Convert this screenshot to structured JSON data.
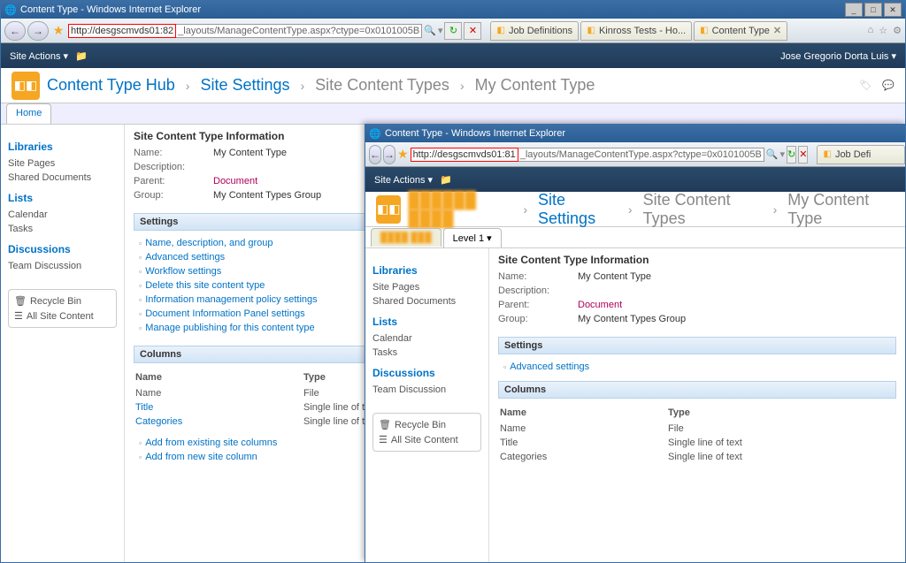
{
  "window1": {
    "title": "Content Type - Windows Internet Explorer",
    "address_highlight": "http://desgscmvds01:82",
    "address_tail": "_layouts/ManageContentType.aspx?ctype=0x0101005B",
    "tabs": [
      {
        "label": "Job Definitions"
      },
      {
        "label": "Kinross Tests - Ho..."
      },
      {
        "label": "Content Type",
        "closable": true
      }
    ],
    "user_name": "Jose Gregorio Dorta Luis",
    "site_actions": "Site Actions ▾",
    "breadcrumb": [
      "Content Type Hub",
      "Site Settings",
      "Site Content Types",
      "My Content Type"
    ],
    "home_tab": "Home",
    "leftnav": {
      "libraries": {
        "head": "Libraries",
        "items": [
          "Site Pages",
          "Shared Documents"
        ]
      },
      "lists": {
        "head": "Lists",
        "items": [
          "Calendar",
          "Tasks"
        ]
      },
      "discussions": {
        "head": "Discussions",
        "items": [
          "Team Discussion"
        ]
      },
      "recycle": "Recycle Bin",
      "allsite": "All Site Content"
    },
    "info": {
      "title": "Site Content Type Information",
      "name_lbl": "Name:",
      "name_val": "My Content Type",
      "desc_lbl": "Description:",
      "desc_val": "",
      "parent_lbl": "Parent:",
      "parent_val": "Document",
      "group_lbl": "Group:",
      "group_val": "My Content Types Group"
    },
    "settings_hdr": "Settings",
    "settings_links": [
      "Name, description, and group",
      "Advanced settings",
      "Workflow settings",
      "Delete this site content type",
      "Information management policy settings",
      "Document Information Panel settings",
      "Manage publishing for this content type"
    ],
    "columns_hdr": "Columns",
    "col_head_name": "Name",
    "col_head_type": "Type",
    "columns": [
      {
        "name": "Name",
        "type": "File",
        "link": false
      },
      {
        "name": "Title",
        "type": "Single line of text",
        "link": true
      },
      {
        "name": "Categories",
        "type": "Single line of text",
        "link": true
      }
    ],
    "col_actions": [
      "Add from existing site columns",
      "Add from new site column"
    ]
  },
  "window2": {
    "title": "Content Type - Windows Internet Explorer",
    "address_highlight": "http://desgscmvds01:81",
    "address_tail": "_layouts/ManageContentType.aspx?ctype=0x0101005B",
    "tab_trunc": "Job Defi",
    "site_actions": "Site Actions ▾",
    "breadcrumb_first_blur": "██████ ████",
    "breadcrumb": [
      "Site Settings",
      "Site Content Types",
      "My Content Type"
    ],
    "tabrow": {
      "first_blur": "████ ███",
      "level": "Level 1 ▾"
    },
    "leftnav": {
      "libraries": {
        "head": "Libraries",
        "items": [
          "Site Pages",
          "Shared Documents"
        ]
      },
      "lists": {
        "head": "Lists",
        "items": [
          "Calendar",
          "Tasks"
        ]
      },
      "discussions": {
        "head": "Discussions",
        "items": [
          "Team Discussion"
        ]
      },
      "recycle": "Recycle Bin",
      "allsite": "All Site Content"
    },
    "info": {
      "title": "Site Content Type Information",
      "name_lbl": "Name:",
      "name_val": "My Content Type",
      "desc_lbl": "Description:",
      "desc_val": "",
      "parent_lbl": "Parent:",
      "parent_val": "Document",
      "group_lbl": "Group:",
      "group_val": "My Content Types Group"
    },
    "settings_hdr": "Settings",
    "settings_links": [
      "Advanced settings"
    ],
    "columns_hdr": "Columns",
    "col_head_name": "Name",
    "col_head_type": "Type",
    "columns": [
      {
        "name": "Name",
        "type": "File"
      },
      {
        "name": "Title",
        "type": "Single line of text"
      },
      {
        "name": "Categories",
        "type": "Single line of text"
      }
    ]
  }
}
